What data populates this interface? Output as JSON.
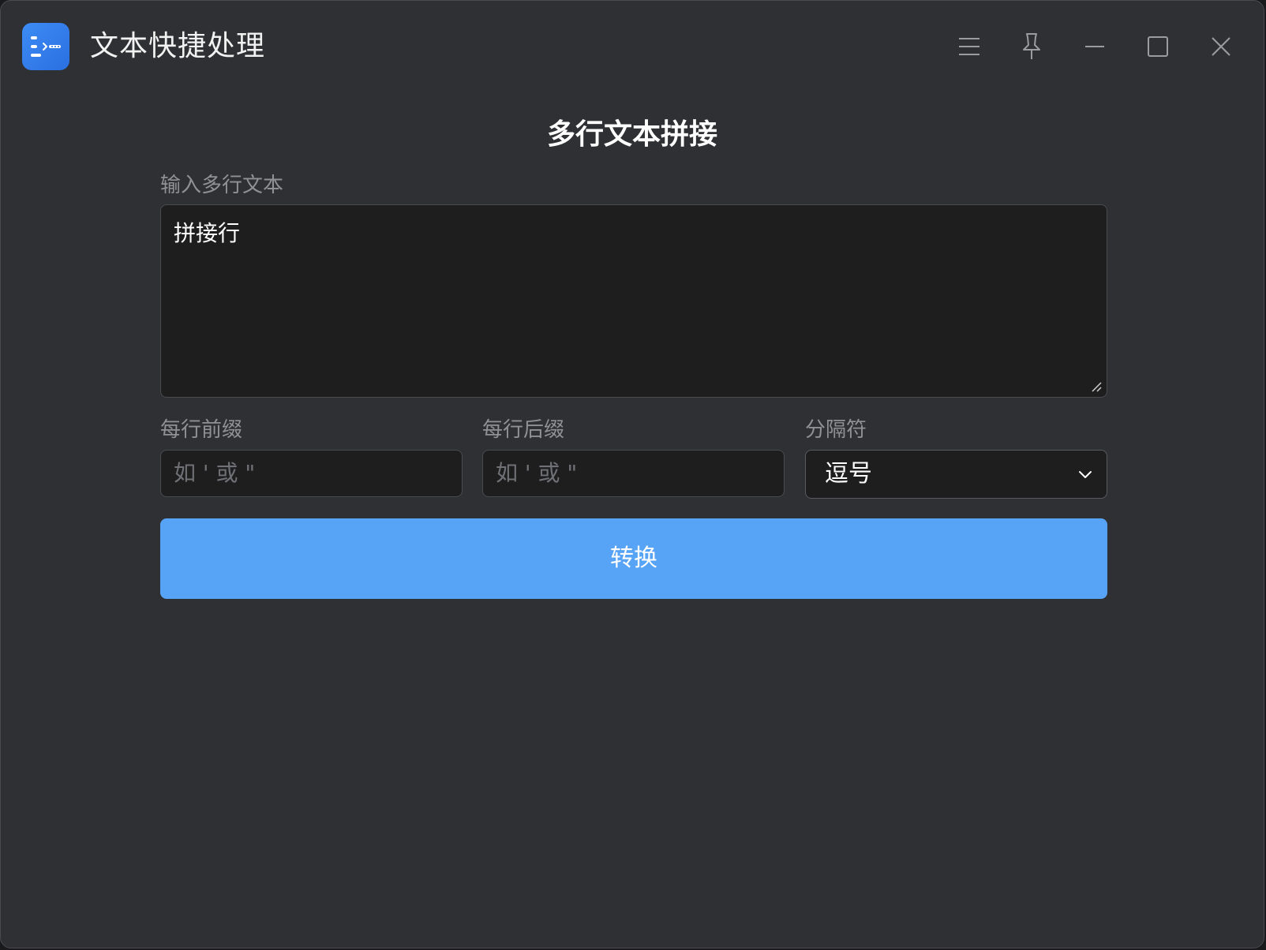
{
  "window": {
    "title": "文本快捷处理",
    "app_icon": "text-join-app-icon",
    "controls": [
      "menu-icon",
      "pin-icon",
      "minimize-icon",
      "maximize-icon",
      "close-icon"
    ]
  },
  "main": {
    "heading": "多行文本拼接",
    "input_label": "输入多行文本",
    "input_value": "拼接行",
    "prefix_label": "每行前缀",
    "prefix_placeholder": "如 ' 或 \"",
    "suffix_label": "每行后缀",
    "suffix_placeholder": "如 ' 或 \"",
    "separator_label": "分隔符",
    "separator_value": "逗号",
    "convert_label": "转换"
  },
  "colors": {
    "accent": "#57a3f5",
    "app_icon": "#3d8cf5",
    "background": "#2f3033",
    "field_background": "#1e1e1f"
  }
}
